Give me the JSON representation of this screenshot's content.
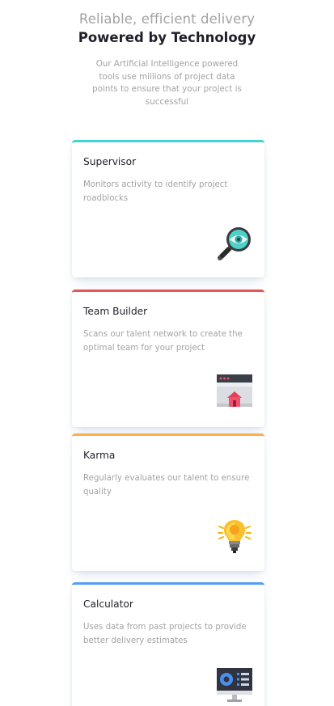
{
  "header": {
    "subtitle": "Reliable, efficient delivery",
    "title": "Powered by Technology",
    "description": "Our Artificial Intelligence powered tools use millions of project data points to ensure that your project is successful"
  },
  "cards": [
    {
      "title": "Supervisor",
      "description": "Monitors activity to identify project roadblocks",
      "accent": "#44d3d2",
      "icon": "magnifier-eye-icon"
    },
    {
      "title": "Team Builder",
      "description": "Scans our talent network to create the optimal team for your project",
      "accent": "#ea5454",
      "icon": "browser-house-icon"
    },
    {
      "title": "Karma",
      "description": "Regularly evaluates our talent to ensure quality",
      "accent": "#fcaf4a",
      "icon": "lightbulb-icon"
    },
    {
      "title": "Calculator",
      "description": "Uses data from past projects to provide better delivery estimates",
      "accent": "#549ef2",
      "icon": "monitor-chart-icon"
    }
  ]
}
